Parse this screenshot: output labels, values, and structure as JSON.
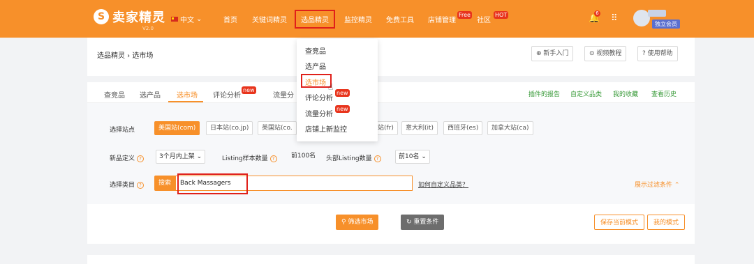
{
  "header": {
    "logo_mark": "S",
    "logo_text": "卖家精灵",
    "version": "V2.0",
    "language": "中文",
    "nav": [
      {
        "label": "首页"
      },
      {
        "label": "关键词精灵"
      },
      {
        "label": "选品精灵"
      },
      {
        "label": "监控精灵"
      },
      {
        "label": "免费工具"
      },
      {
        "label": "店铺管理",
        "tag": "Free"
      },
      {
        "label": "社区",
        "tag": "HOT"
      }
    ],
    "bell_count": "6",
    "member_badge": "独立会员"
  },
  "breadcrumb": "选品精灵 › 选市场",
  "help_buttons": [
    {
      "label": "新手入门",
      "icon": "compass-icon"
    },
    {
      "label": "视频教程",
      "icon": "play-icon"
    },
    {
      "label": "使用帮助",
      "icon": "question-icon"
    }
  ],
  "tabs": [
    {
      "label": "查竞品"
    },
    {
      "label": "选产品"
    },
    {
      "label": "选市场"
    },
    {
      "label": "评论分析",
      "tag": "new"
    },
    {
      "label": "流量分"
    }
  ],
  "right_links": [
    "插件的报告",
    "自定义品类",
    "我的收藏",
    "查看历史"
  ],
  "filters": {
    "site_label": "选择站点",
    "sites": [
      "美国站(com)",
      "日本站(co.jp)",
      "英国站(co.",
      "站(fr)",
      "意大利(it)",
      "西班牙(es)",
      "加拿大站(ca)"
    ],
    "new_label": "新品定义",
    "new_value": "3个月内上架",
    "listing_label": "Listing样本数量",
    "listing_value": "前100名",
    "head_label": "头部Listing数量",
    "head_value": "前10名",
    "category_label": "选择类目",
    "search_btn": "搜索",
    "search_value": "Back Massagers",
    "custom_link": "如何自定义品类？",
    "expand": "展示过滤条件"
  },
  "actions": {
    "filter": "筛选市场",
    "reset": "重置条件",
    "save": "保存当前模式",
    "mine": "我的模式"
  },
  "dropdown": [
    {
      "label": "查竞品"
    },
    {
      "label": "选产品"
    },
    {
      "label": "选市场"
    },
    {
      "label": "评论分析",
      "tag": "new"
    },
    {
      "label": "流量分析",
      "tag": "new"
    },
    {
      "label": "店铺上新监控"
    }
  ],
  "colors": {
    "brand": "#f7902a",
    "highlight": "#e0201a",
    "badge": "#e8341c"
  }
}
